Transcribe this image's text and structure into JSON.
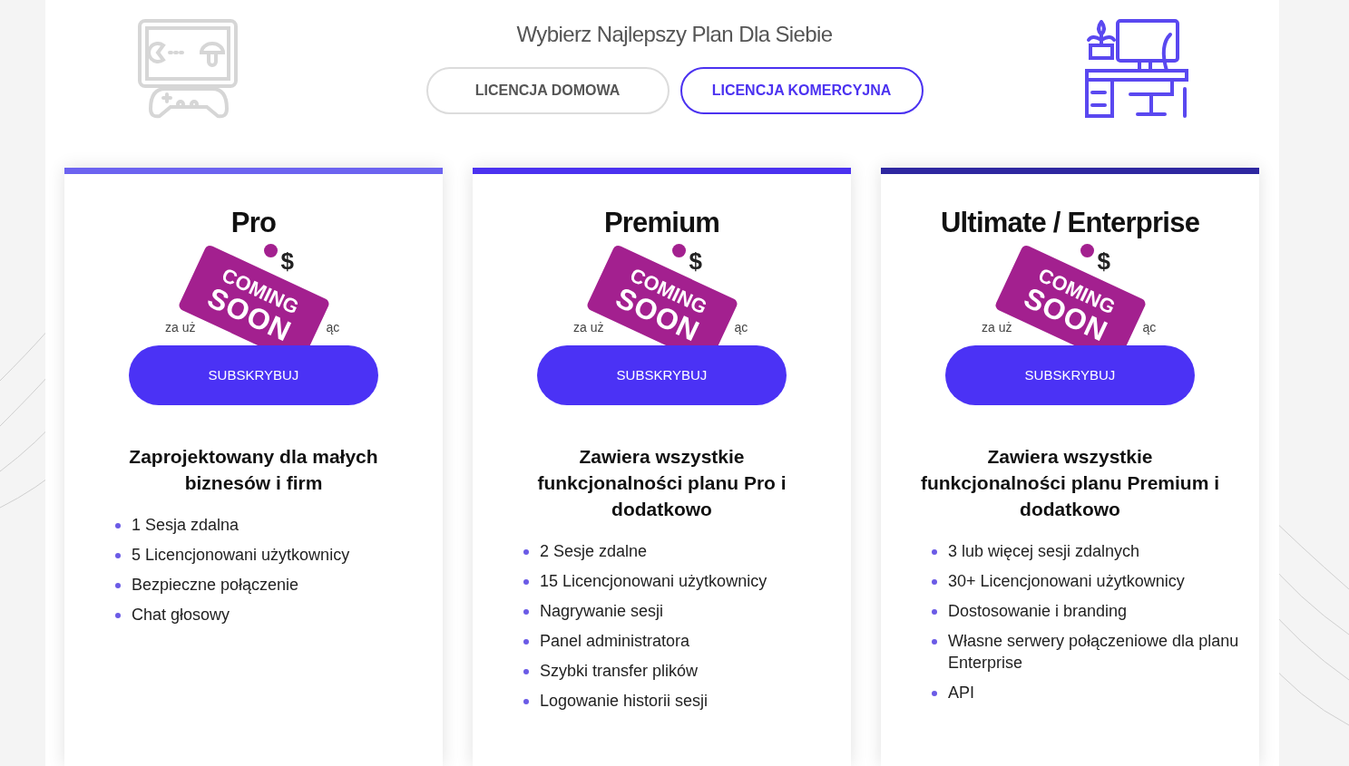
{
  "header": {
    "title": "Wybierz Najlepszy Plan Dla Siebie",
    "tabs": [
      {
        "label": "LICENCJA DOMOWA",
        "selected": false
      },
      {
        "label": "LICENCJA KOMERCYJNA",
        "selected": true
      }
    ]
  },
  "plans": [
    {
      "name": "Pro",
      "color": "#6c63f0",
      "price": "$",
      "period_start": "za uż",
      "period_end": "ąc",
      "sign": [
        "COMING",
        "SOON"
      ],
      "button": "SUBSKRYBUJ",
      "description": "Zaprojektowany dla małych biznesów i firm",
      "features": [
        "1 Sesja zdalna",
        "5 Licencjonowani użytkownicy",
        "Bezpieczne połączenie",
        "Chat głosowy"
      ]
    },
    {
      "name": "Premium",
      "color": "#4b32f0",
      "price": "$",
      "period_start": "za uż",
      "period_end": "ąc",
      "sign": [
        "COMING",
        "SOON"
      ],
      "button": "SUBSKRYBUJ",
      "description": "Zawiera wszystkie funkcjonalności planu Pro i dodatkowo",
      "features": [
        "2 Sesje zdalne",
        "15 Licencjonowani użytkownicy",
        "Nagrywanie sesji",
        "Panel administratora",
        "Szybki transfer plików",
        "Logowanie historii sesji"
      ]
    },
    {
      "name": "Ultimate / Enterprise",
      "color": "#2e27a0",
      "price": "$",
      "period_start": "za uż",
      "period_end": "ąc",
      "sign": [
        "COMING",
        "SOON"
      ],
      "button": "SUBSKRYBUJ",
      "description": "Zawiera wszystkie funkcjonalności planu Premium i dodatkowo",
      "features": [
        "3 lub więcej sesji zdalnych",
        "30+ Licencjonowani użytkownicy",
        "Dostosowanie i branding",
        "Własne serwery połączeniowe dla planu Enterprise",
        "API"
      ]
    }
  ]
}
